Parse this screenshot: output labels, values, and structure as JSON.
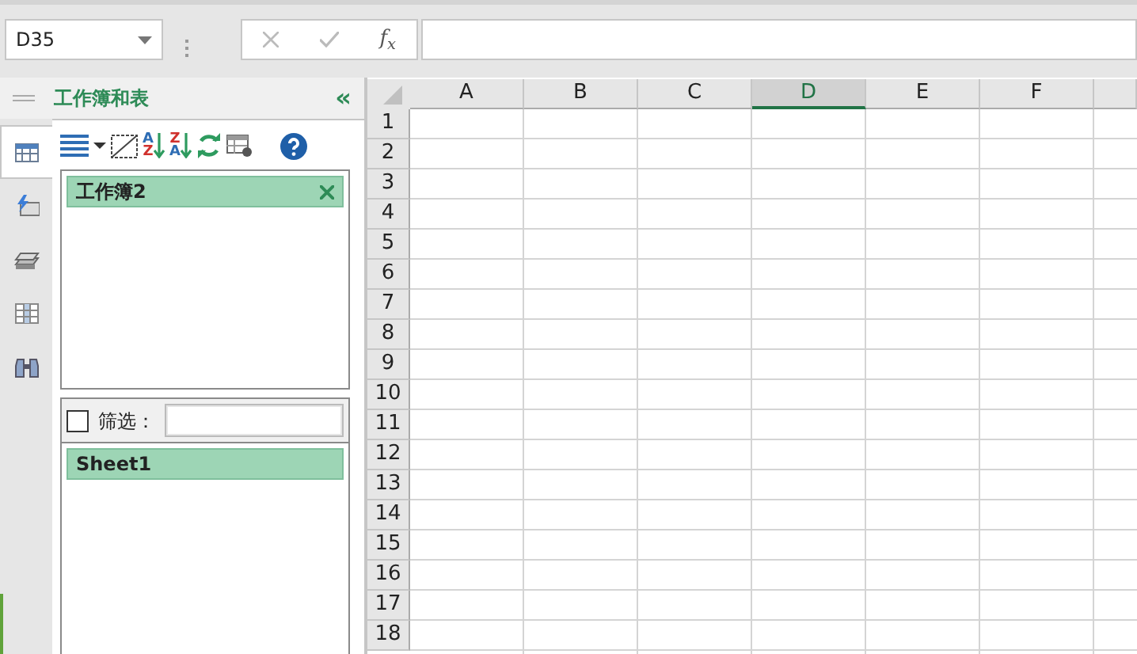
{
  "name_box": {
    "value": "D35"
  },
  "formula_bar": {
    "fx_label": "f$_{x}$"
  },
  "panel": {
    "title": "工作簿和表",
    "collapse": "«",
    "side_tabs": [
      {
        "kind": "table",
        "selected": true
      },
      {
        "kind": "flash",
        "selected": false
      },
      {
        "kind": "stack",
        "selected": false
      },
      {
        "kind": "columns",
        "selected": false
      },
      {
        "kind": "binoculars",
        "selected": false
      }
    ],
    "toolbar": [
      {
        "kind": "list"
      },
      {
        "kind": "caret"
      },
      {
        "kind": "resize"
      },
      {
        "kind": "sort",
        "glyphs": [
          "A",
          "Z"
        ]
      },
      {
        "kind": "sort",
        "glyphs": [
          "Z",
          "A"
        ]
      },
      {
        "kind": "refresh"
      },
      {
        "kind": "settings"
      },
      {
        "kind": "help"
      }
    ],
    "workbooks": [
      {
        "name": "工作簿2",
        "selected": true
      }
    ],
    "filter": {
      "checked": false,
      "label": "筛选："
    },
    "sheets": [
      {
        "name": "Sheet1",
        "selected": true
      }
    ]
  },
  "sheet": {
    "columns": [
      {
        "label": "A",
        "selected": false
      },
      {
        "label": "B",
        "selected": false
      },
      {
        "label": "C",
        "selected": false
      },
      {
        "label": "D",
        "selected": true
      },
      {
        "label": "E",
        "selected": false
      },
      {
        "label": "F",
        "selected": false
      }
    ],
    "rows": [
      "1",
      "2",
      "3",
      "4",
      "5",
      "6",
      "7",
      "8",
      "9",
      "10",
      "11",
      "12",
      "13",
      "14",
      "15",
      "16",
      "17",
      "18"
    ]
  }
}
